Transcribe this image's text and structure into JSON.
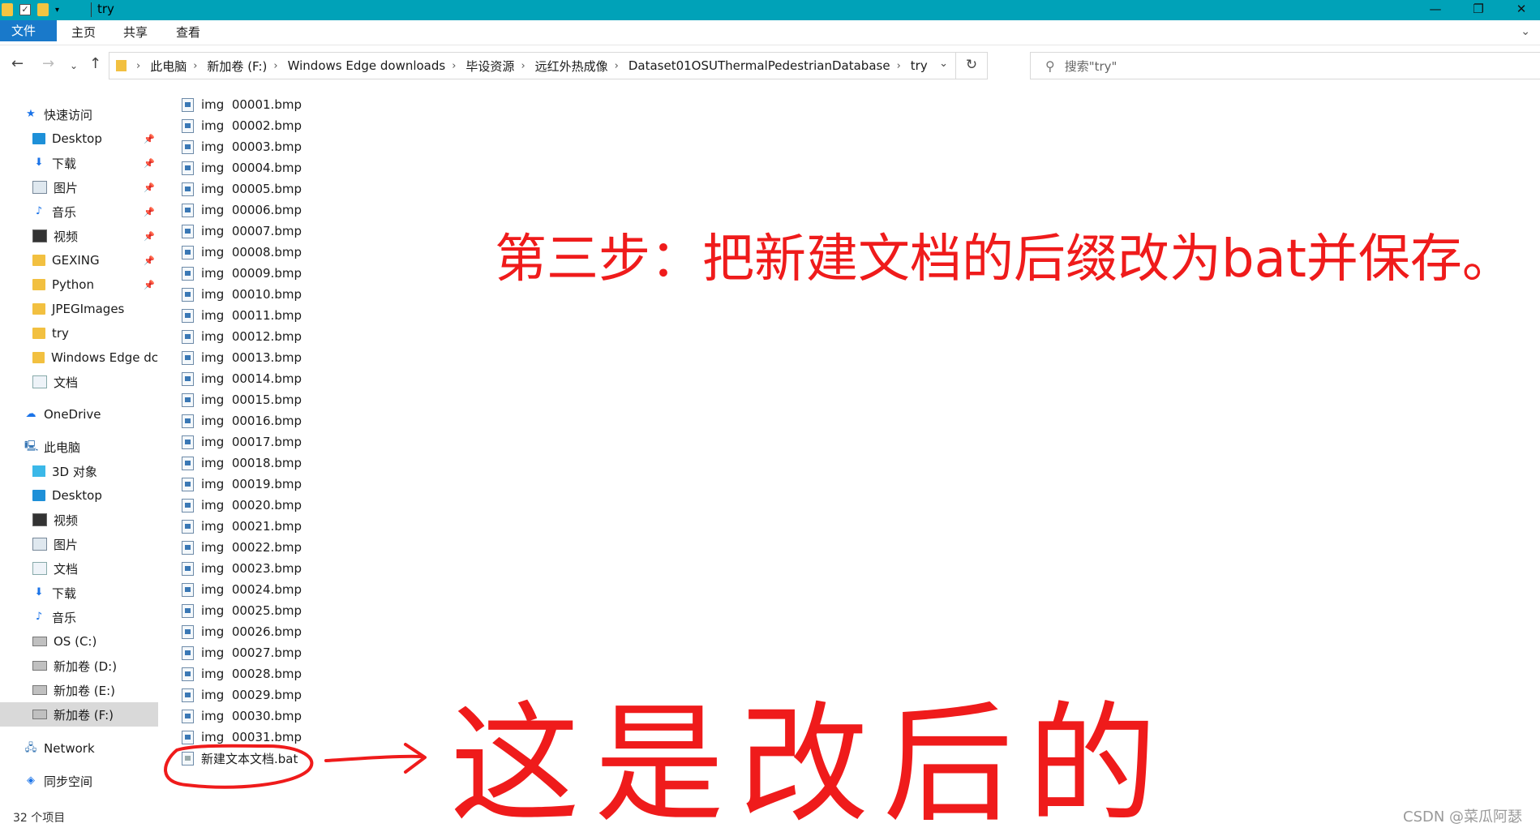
{
  "window": {
    "title": "try",
    "controls": [
      "—",
      "❐",
      "✕"
    ]
  },
  "ribbon": {
    "tabs": [
      "文件",
      "主页",
      "共享",
      "查看"
    ]
  },
  "address": {
    "crumbs": [
      "此电脑",
      "新加卷 (F:)",
      "Windows Edge downloads",
      "毕设资源",
      "远红外热成像",
      "Dataset01OSUThermalPedestrianDatabase",
      "try"
    ]
  },
  "search": {
    "placeholder": "搜索\"try\""
  },
  "sidebar": {
    "quick_access": "快速访问",
    "quick_items": [
      {
        "label": "Desktop",
        "icon": "desktop-icon",
        "pinned": true
      },
      {
        "label": "下载",
        "icon": "download-icon",
        "pinned": true
      },
      {
        "label": "图片",
        "icon": "pictures-icon",
        "pinned": true
      },
      {
        "label": "音乐",
        "icon": "music-icon",
        "pinned": true
      },
      {
        "label": "视频",
        "icon": "video-icon",
        "pinned": true
      },
      {
        "label": "GEXING",
        "icon": "folder-icon",
        "pinned": true
      },
      {
        "label": "Python",
        "icon": "folder-icon",
        "pinned": true
      },
      {
        "label": "JPEGImages",
        "icon": "folder-icon",
        "pinned": false
      },
      {
        "label": "try",
        "icon": "folder-icon",
        "pinned": false
      },
      {
        "label": "Windows Edge dc",
        "icon": "folder-icon",
        "pinned": false
      },
      {
        "label": "文档",
        "icon": "documents-icon",
        "pinned": false
      }
    ],
    "onedrive": "OneDrive",
    "this_pc": "此电脑",
    "pc_items": [
      {
        "label": "3D 对象",
        "icon": "3d-objects-icon"
      },
      {
        "label": "Desktop",
        "icon": "desktop-icon"
      },
      {
        "label": "视频",
        "icon": "video-icon"
      },
      {
        "label": "图片",
        "icon": "pictures-icon"
      },
      {
        "label": "文档",
        "icon": "documents-icon"
      },
      {
        "label": "下载",
        "icon": "download-icon"
      },
      {
        "label": "音乐",
        "icon": "music-icon"
      },
      {
        "label": "OS (C:)",
        "icon": "drive-icon"
      },
      {
        "label": "新加卷 (D:)",
        "icon": "drive-icon"
      },
      {
        "label": "新加卷 (E:)",
        "icon": "drive-icon"
      },
      {
        "label": "新加卷 (F:)",
        "icon": "drive-icon",
        "selected": true
      }
    ],
    "network": "Network",
    "sync": "同步空间"
  },
  "files": [
    "img  00001.bmp",
    "img  00002.bmp",
    "img  00003.bmp",
    "img  00004.bmp",
    "img  00005.bmp",
    "img  00006.bmp",
    "img  00007.bmp",
    "img  00008.bmp",
    "img  00009.bmp",
    "img  00010.bmp",
    "img  00011.bmp",
    "img  00012.bmp",
    "img  00013.bmp",
    "img  00014.bmp",
    "img  00015.bmp",
    "img  00016.bmp",
    "img  00017.bmp",
    "img  00018.bmp",
    "img  00019.bmp",
    "img  00020.bmp",
    "img  00021.bmp",
    "img  00022.bmp",
    "img  00023.bmp",
    "img  00024.bmp",
    "img  00025.bmp",
    "img  00026.bmp",
    "img  00027.bmp",
    "img  00028.bmp",
    "img  00029.bmp",
    "img  00030.bmp",
    "img  00031.bmp",
    "新建文本文档.bat"
  ],
  "status": {
    "count": "32 个项目"
  },
  "annotation": {
    "step_text": "第三步：把新建文档的后缀改为bat并保存。",
    "handwritten_note": "这是改后的",
    "color": "#ef1b1b"
  },
  "watermark": "CSDN @菜瓜阿瑟"
}
